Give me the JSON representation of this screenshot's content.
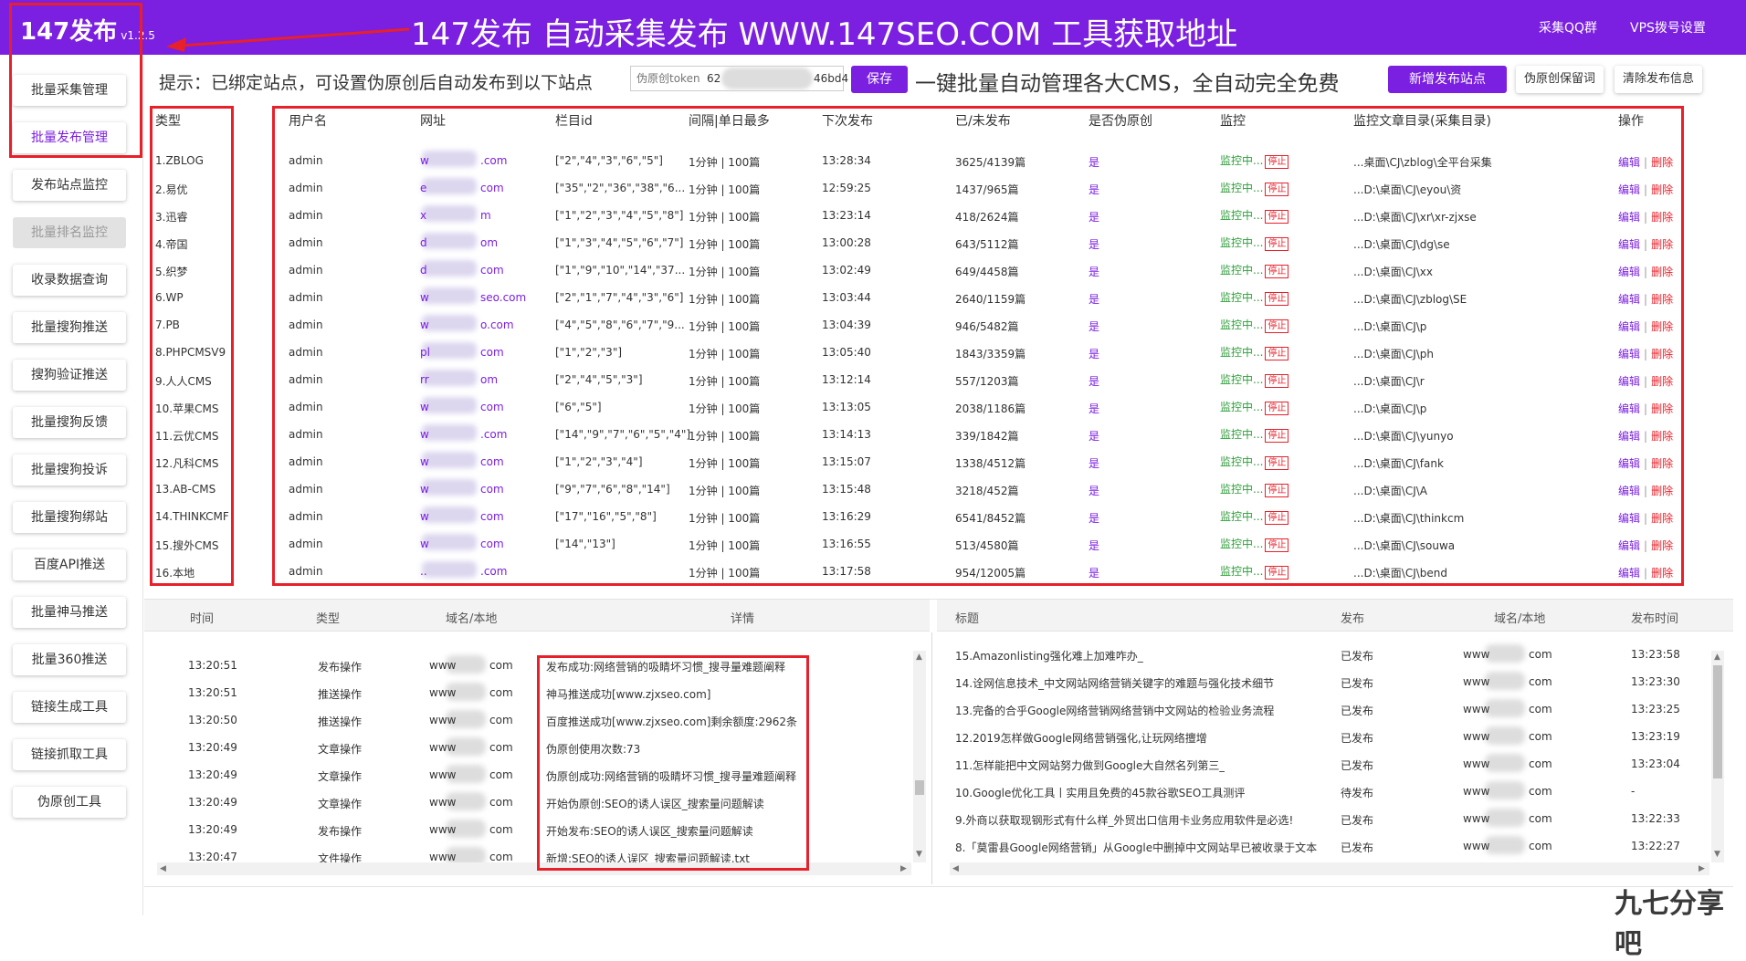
{
  "app": {
    "title": "147发布",
    "version": "v1.2.5"
  },
  "banner": "147发布 自动采集发布 WWW.147SEO.COM 工具获取地址",
  "top_buttons": {
    "qq": "采集QQ群",
    "vps": "VPS拨号设置"
  },
  "sidebar": {
    "items": [
      {
        "label": "批量采集管理",
        "state": "normal"
      },
      {
        "label": "批量发布管理",
        "state": "active"
      },
      {
        "label": "发布站点监控",
        "state": "normal"
      },
      {
        "label": "批量排名监控",
        "state": "disabled"
      },
      {
        "label": "收录数据查询",
        "state": "normal"
      },
      {
        "label": "批量搜狗推送",
        "state": "normal"
      },
      {
        "label": "搜狗验证推送",
        "state": "normal"
      },
      {
        "label": "批量搜狗反馈",
        "state": "normal"
      },
      {
        "label": "批量搜狗投诉",
        "state": "normal"
      },
      {
        "label": "批量搜狗绑站",
        "state": "normal"
      },
      {
        "label": "百度API推送",
        "state": "normal"
      },
      {
        "label": "批量神马推送",
        "state": "normal"
      },
      {
        "label": "批量360推送",
        "state": "normal"
      },
      {
        "label": "链接生成工具",
        "state": "normal"
      },
      {
        "label": "链接抓取工具",
        "state": "normal"
      },
      {
        "label": "伪原创工具",
        "state": "normal"
      }
    ]
  },
  "toolbar": {
    "hint": "提示：已绑定站点，可设置伪原创后自动发布到以下站点",
    "token_placeholder": "伪原创token",
    "token_prefix": "62",
    "token_suffix": "46bd4",
    "save_label": "保存",
    "promo": "一键批量自动管理各大CMS，全自动完全免费",
    "add_site": "新增发布站点",
    "keep_pseudo": "伪原创保留词",
    "clear_info": "清除发布信息"
  },
  "site_table": {
    "headers": [
      "类型",
      "用户名",
      "网址",
      "栏目id",
      "间隔|单日最多",
      "下次发布",
      "已/未发布",
      "是否伪原创",
      "监控",
      "监控文章目录(采集目录)",
      "操作"
    ],
    "monitor_text": "监控中...",
    "stop_text": "停止",
    "edit_text": "编辑",
    "delete_text": "删除",
    "rows": [
      {
        "type": "1.ZBLOG",
        "user": "admin",
        "url_a": "w",
        "url_b": ".com",
        "cat": "[\"2\",\"4\",\"3\",\"6\",\"5\"]",
        "interval": "1分钟 | 100篇",
        "next": "13:28:34",
        "count": "3625/4139篇",
        "pseudo": "是",
        "dir": "...桌面\\CJ\\zblog\\全平台采集"
      },
      {
        "type": "2.易优",
        "user": "admin",
        "url_a": "e",
        "url_b": "com",
        "cat": "[\"35\",\"2\",\"36\",\"38\",\"6...",
        "interval": "1分钟 | 100篇",
        "next": "12:59:25",
        "count": "1437/965篇",
        "pseudo": "是",
        "dir": "...D:\\桌面\\CJ\\eyou\\资"
      },
      {
        "type": "3.迅睿",
        "user": "admin",
        "url_a": "x",
        "url_b": "m",
        "cat": "[\"1\",\"2\",\"3\",\"4\",\"5\",\"8\"]",
        "interval": "1分钟 | 100篇",
        "next": "13:23:14",
        "count": "418/2624篇",
        "pseudo": "是",
        "dir": "...D:\\桌面\\CJ\\xr\\xr-zjxse"
      },
      {
        "type": "4.帝国",
        "user": "admin",
        "url_a": "d",
        "url_b": "om",
        "cat": "[\"1\",\"3\",\"4\",\"5\",\"6\",\"7\"]",
        "interval": "1分钟 | 100篇",
        "next": "13:00:28",
        "count": "643/5112篇",
        "pseudo": "是",
        "dir": "...D:\\桌面\\CJ\\dg\\se"
      },
      {
        "type": "5.织梦",
        "user": "admin",
        "url_a": "d",
        "url_b": "com",
        "cat": "[\"1\",\"9\",\"10\",\"14\",\"37...",
        "interval": "1分钟 | 100篇",
        "next": "13:02:49",
        "count": "649/4458篇",
        "pseudo": "是",
        "dir": "...D:\\桌面\\CJ\\xx"
      },
      {
        "type": "6.WP",
        "user": "admin",
        "url_a": "w",
        "url_b": "seo.com",
        "cat": "[\"2\",\"1\",\"7\",\"4\",\"3\",\"6\"]",
        "interval": "1分钟 | 100篇",
        "next": "13:03:44",
        "count": "2640/1159篇",
        "pseudo": "是",
        "dir": "...D:\\桌面\\CJ\\zblog\\SE"
      },
      {
        "type": "7.PB",
        "user": "admin",
        "url_a": "w",
        "url_b": "o.com",
        "cat": "[\"4\",\"5\",\"8\",\"6\",\"7\",\"9...",
        "interval": "1分钟 | 100篇",
        "next": "13:04:39",
        "count": "946/5482篇",
        "pseudo": "是",
        "dir": "...D:\\桌面\\CJ\\p"
      },
      {
        "type": "8.PHPCMSV9",
        "user": "admin",
        "url_a": "pl",
        "url_b": "com",
        "cat": "[\"1\",\"2\",\"3\"]",
        "interval": "1分钟 | 100篇",
        "next": "13:05:40",
        "count": "1843/3359篇",
        "pseudo": "是",
        "dir": "...D:\\桌面\\CJ\\ph"
      },
      {
        "type": "9.人人CMS",
        "user": "admin",
        "url_a": "rr",
        "url_b": "om",
        "cat": "[\"2\",\"4\",\"5\",\"3\"]",
        "interval": "1分钟 | 100篇",
        "next": "13:12:14",
        "count": "557/1203篇",
        "pseudo": "是",
        "dir": "...D:\\桌面\\CJ\\r"
      },
      {
        "type": "10.苹果CMS",
        "user": "admin",
        "url_a": "w",
        "url_b": "com",
        "cat": "[\"6\",\"5\"]",
        "interval": "1分钟 | 100篇",
        "next": "13:13:05",
        "count": "2038/1186篇",
        "pseudo": "是",
        "dir": "...D:\\桌面\\CJ\\p"
      },
      {
        "type": "11.云优CMS",
        "user": "admin",
        "url_a": "w",
        "url_b": ".com",
        "cat": "[\"14\",\"9\",\"7\",\"6\",\"5\",\"4\"]",
        "interval": "1分钟 | 100篇",
        "next": "13:14:13",
        "count": "339/1842篇",
        "pseudo": "是",
        "dir": "...D:\\桌面\\CJ\\yunyo"
      },
      {
        "type": "12.凡科CMS",
        "user": "admin",
        "url_a": "w",
        "url_b": "com",
        "cat": "[\"1\",\"2\",\"3\",\"4\"]",
        "interval": "1分钟 | 100篇",
        "next": "13:15:07",
        "count": "1338/4512篇",
        "pseudo": "是",
        "dir": "...D:\\桌面\\CJ\\fank"
      },
      {
        "type": "13.AB-CMS",
        "user": "admin",
        "url_a": "w",
        "url_b": "com",
        "cat": "[\"9\",\"7\",\"6\",\"8\",\"14\"]",
        "interval": "1分钟 | 100篇",
        "next": "13:15:48",
        "count": "3218/452篇",
        "pseudo": "是",
        "dir": "...D:\\桌面\\CJ\\A"
      },
      {
        "type": "14.THINKCMF",
        "user": "admin",
        "url_a": "w",
        "url_b": "com",
        "cat": "[\"17\",\"16\",\"5\",\"8\"]",
        "interval": "1分钟 | 100篇",
        "next": "13:16:29",
        "count": "6541/8452篇",
        "pseudo": "是",
        "dir": "...D:\\桌面\\CJ\\thinkcm"
      },
      {
        "type": "15.搜外CMS",
        "user": "admin",
        "url_a": "w",
        "url_b": "com",
        "cat": "[\"14\",\"13\"]",
        "interval": "1分钟 | 100篇",
        "next": "13:16:55",
        "count": "513/4580篇",
        "pseudo": "是",
        "dir": "...D:\\桌面\\CJ\\souwa"
      },
      {
        "type": "16.本地",
        "user": "admin",
        "url_a": "..",
        "url_b": ".com",
        "cat": "",
        "interval": "1分钟 | 100篇",
        "next": "13:17:58",
        "count": "954/12005篇",
        "pseudo": "是",
        "dir": "...D:\\桌面\\CJ\\bend"
      }
    ]
  },
  "log_panel": {
    "headers": [
      "时间",
      "类型",
      "域名/本地",
      "详情"
    ],
    "rows": [
      {
        "time": "13:20:51",
        "type": "发布操作",
        "dom_a": "www",
        "dom_b": "com",
        "detail": "发布成功:网络营销的吸睛坏习惯_搜寻量难题阐释"
      },
      {
        "time": "13:20:51",
        "type": "推送操作",
        "dom_a": "www",
        "dom_b": "com",
        "detail": "神马推送成功[www.zjxseo.com]"
      },
      {
        "time": "13:20:50",
        "type": "推送操作",
        "dom_a": "www",
        "dom_b": "com",
        "detail": "百度推送成功[www.zjxseo.com]剩余额度:2962条"
      },
      {
        "time": "13:20:49",
        "type": "文章操作",
        "dom_a": "www",
        "dom_b": "com",
        "detail": "伪原创使用次数:73"
      },
      {
        "time": "13:20:49",
        "type": "文章操作",
        "dom_a": "www",
        "dom_b": "com",
        "detail": "伪原创成功:网络营销的吸睛坏习惯_搜寻量难题阐释"
      },
      {
        "time": "13:20:49",
        "type": "文章操作",
        "dom_a": "www",
        "dom_b": "com",
        "detail": "开始伪原创:SEO的诱人误区_搜索量问题解读"
      },
      {
        "time": "13:20:49",
        "type": "发布操作",
        "dom_a": "www",
        "dom_b": "com",
        "detail": "开始发布:SEO的诱人误区_搜索量问题解读"
      },
      {
        "time": "13:20:47",
        "type": "文件操作",
        "dom_a": "www",
        "dom_b": "com",
        "detail": "新增:SEO的诱人误区_搜索量问题解读.txt"
      }
    ]
  },
  "article_panel": {
    "headers": [
      "标题",
      "发布",
      "域名/本地",
      "发布时间"
    ],
    "rows": [
      {
        "title": "15.Amazonlisting强化难上加难咋办_",
        "status": "已发布",
        "dom_a": "www",
        "dom_b": "com",
        "time": "13:23:58"
      },
      {
        "title": "14.诠网信息技术_中文网站网络营销关键字的难题与强化技术细节",
        "status": "已发布",
        "dom_a": "www",
        "dom_b": "com",
        "time": "13:23:30"
      },
      {
        "title": "13.完备的合乎Google网络营销网络营销中文网站的检验业务流程",
        "status": "已发布",
        "dom_a": "www",
        "dom_b": "com",
        "time": "13:23:25"
      },
      {
        "title": "12.2019怎样做Google网络营销强化,让玩网络擅增",
        "status": "已发布",
        "dom_a": "www",
        "dom_b": "com",
        "time": "13:23:19"
      },
      {
        "title": "11.怎样能把中文网站努力做到Google大自然名列第三_",
        "status": "已发布",
        "dom_a": "www",
        "dom_b": "com",
        "time": "13:23:04"
      },
      {
        "title": "10.Google优化工具丨实用且免费的45款谷歌SEO工具测评",
        "status": "待发布",
        "dom_a": "www",
        "dom_b": "com",
        "time": "-"
      },
      {
        "title": "9.外商以获取现钢形式有什么样_外贸出口信用卡业务应用软件是必选!",
        "status": "已发布",
        "dom_a": "www",
        "dom_b": "com",
        "time": "13:22:33"
      },
      {
        "title": "8.「莫雷县Google网络营销」从Google中删掉中文网站早已被收录于文本",
        "status": "已发布",
        "dom_a": "www",
        "dom_b": "com",
        "time": "13:22:27"
      }
    ]
  },
  "watermark": "九七分享吧",
  "colors": {
    "accent": "#7b1fe0",
    "annotation": "#e8202a",
    "monitor": "#2e9e3a"
  }
}
